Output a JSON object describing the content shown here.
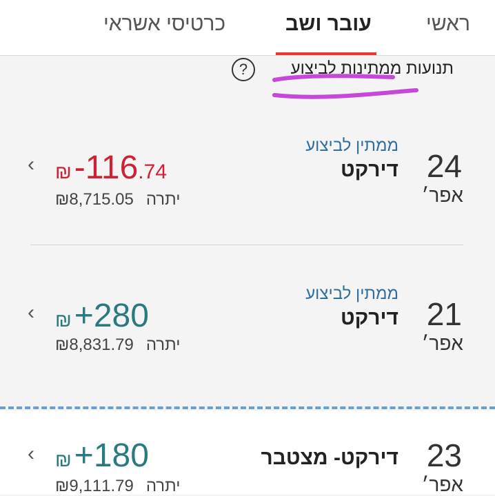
{
  "tabs": [
    {
      "label": "ראשי"
    },
    {
      "label": "עובר ושב"
    },
    {
      "label": "כרטיסי אשראי"
    }
  ],
  "pending_section": {
    "title": "תנועות ממתינות לביצוע",
    "help_glyph": "?"
  },
  "transactions": [
    {
      "day": "24",
      "month": "אפר׳",
      "status": "ממתין לביצוע",
      "payee": "דירקט",
      "sign": "-",
      "amount_int": "116",
      "amount_dec": ".74",
      "currency": "₪",
      "balance_label": "יתרה",
      "balance": "₪8,715.05"
    },
    {
      "day": "21",
      "month": "אפר׳",
      "status": "ממתין לביצוע",
      "payee": "דירקט",
      "sign": "+",
      "amount_int": "280",
      "amount_dec": "",
      "currency": "₪",
      "balance_label": "יתרה",
      "balance": "₪8,831.79"
    },
    {
      "day": "23",
      "month": "אפר׳",
      "status": "",
      "payee": "דירקט- מצטבר",
      "sign": "+",
      "amount_int": "180",
      "amount_dec": "",
      "currency": "₪",
      "balance_label": "יתרה",
      "balance": "₪9,111.79"
    }
  ],
  "colors": {
    "tab_indicator": "#e63a2e",
    "negative": "#cc2233",
    "positive": "#2a7a80",
    "pending_status": "#2f6f9e",
    "annotation": "#c548d8",
    "separator": "#6b9fd4"
  },
  "icons": {
    "chevron": "chevron-left-icon",
    "help": "help-icon"
  }
}
